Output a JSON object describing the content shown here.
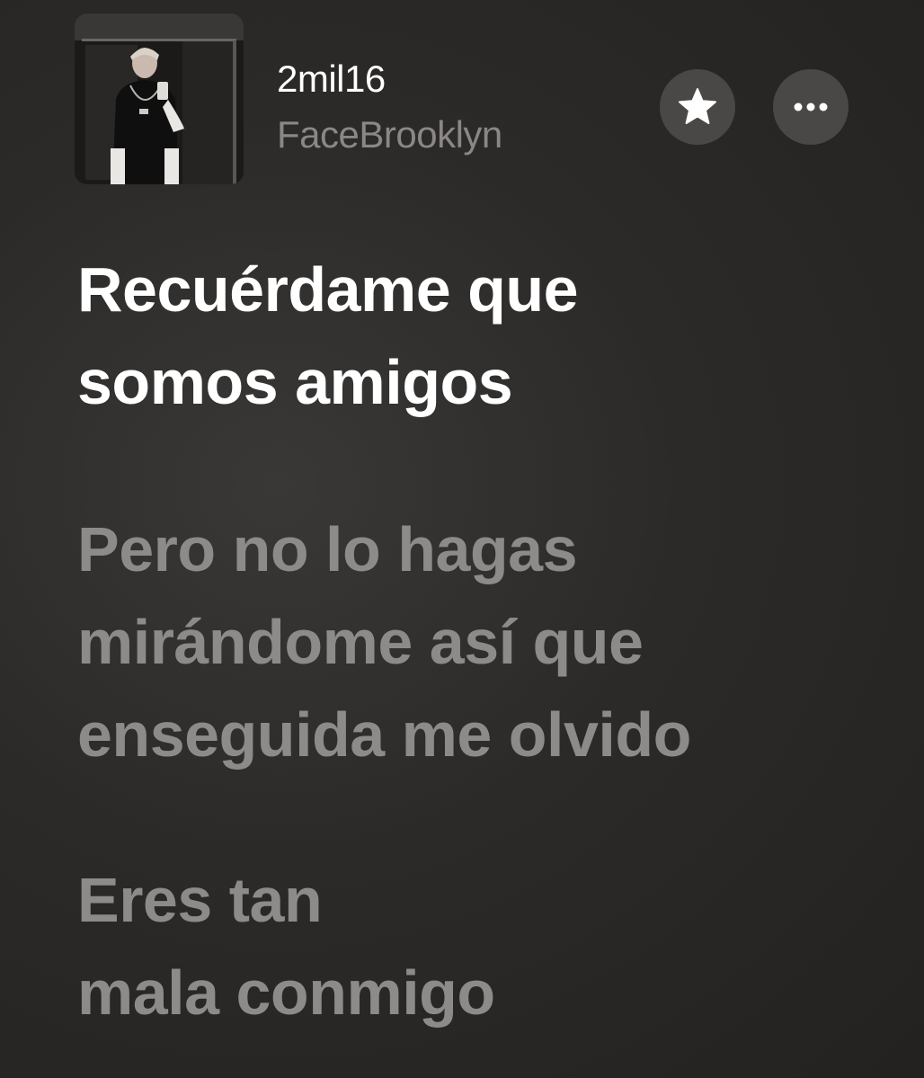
{
  "now_playing": {
    "title": "2mil16",
    "artist": "FaceBrooklyn",
    "artwork_icon": "album-artwork"
  },
  "controls": {
    "favorite_icon": "star-icon",
    "more_icon": "ellipsis-icon"
  },
  "lyrics": {
    "active": {
      "lines": [
        "Recuérdame que",
        "somos amigos"
      ]
    },
    "upcoming": [
      {
        "lines": [
          "Pero no lo hagas",
          "mirándome así que",
          "enseguida me olvido"
        ]
      },
      {
        "lines": [
          "Eres tan",
          "mala conmigo"
        ]
      }
    ]
  },
  "colors": {
    "active_lyric": "#ffffff",
    "inactive_lyric": "#8d8b89",
    "artist_text": "#8a8785",
    "button_background": "#4a4846"
  }
}
